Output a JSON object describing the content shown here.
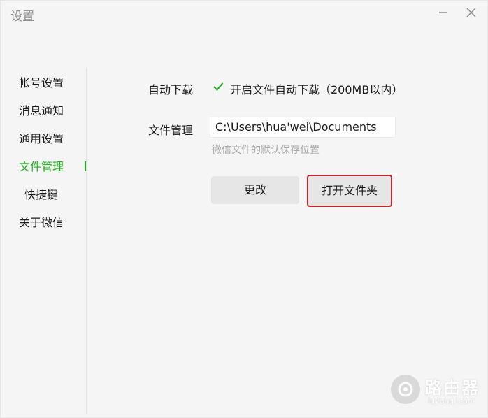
{
  "window": {
    "title": "设置"
  },
  "sidebar": {
    "items": [
      {
        "label": "帐号设置"
      },
      {
        "label": "消息通知"
      },
      {
        "label": "通用设置"
      },
      {
        "label": "文件管理"
      },
      {
        "label": "快捷键"
      },
      {
        "label": "关于微信"
      }
    ],
    "active_index": 3
  },
  "settings": {
    "auto_download_label": "自动下载",
    "auto_download_checked": true,
    "auto_download_option": "开启文件自动下载（200MB以内）",
    "file_manage_label": "文件管理",
    "path_value": "C:\\Users\\hua'wei\\Documents",
    "path_hint": "微信文件的默认保存位置",
    "change_button": "更改",
    "open_folder_button": "打开文件夹"
  },
  "watermark": {
    "name": "路由器",
    "url": "luyouqi.com"
  },
  "colors": {
    "accent": "#1aad19",
    "highlight_border": "#c0272d"
  }
}
